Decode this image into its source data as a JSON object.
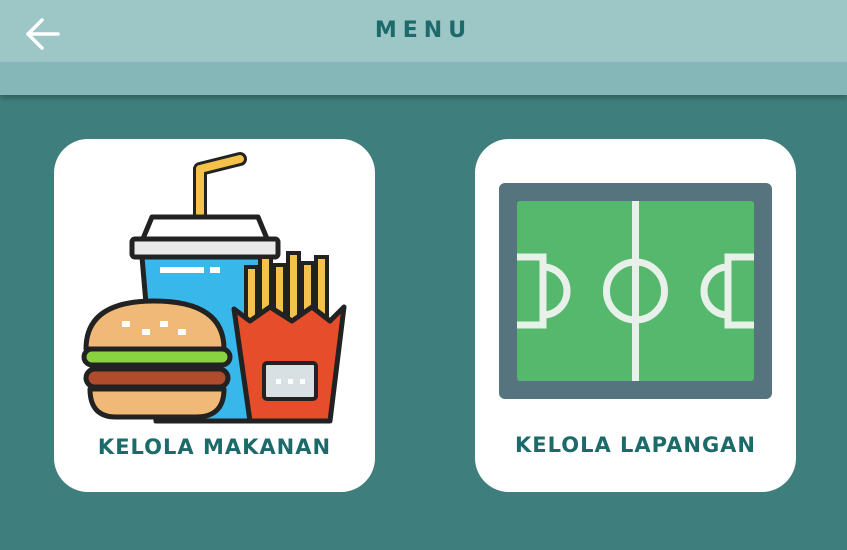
{
  "header": {
    "title": "MENU",
    "back_icon": "arrow-left-icon"
  },
  "menu": {
    "items": [
      {
        "label": "KELOLA MAKANAN",
        "icon": "fast-food-icon"
      },
      {
        "label": "KELOLA LAPANGAN",
        "icon": "soccer-field-icon"
      }
    ]
  },
  "colors": {
    "background": "#3e7f7d",
    "header": "#9dc6c7",
    "subheader": "#86b7b8",
    "title_text": "#1c6a6a",
    "card": "#ffffff",
    "field_green": "#55b86d",
    "field_border": "#56747d"
  }
}
